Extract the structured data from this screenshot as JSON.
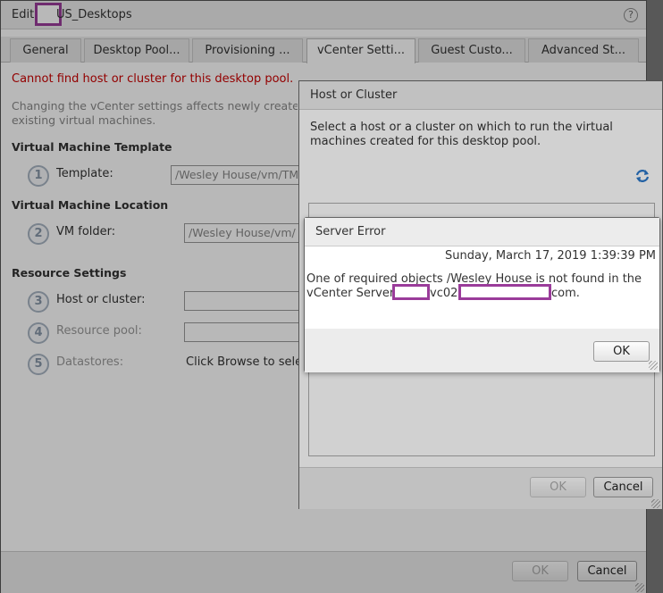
{
  "main_dialog": {
    "title_prefix": "Edit",
    "title_suffix": "US_Desktops",
    "help_icon": "?",
    "tabs": [
      {
        "label": "General"
      },
      {
        "label": "Desktop Pool..."
      },
      {
        "label": "Provisioning ..."
      },
      {
        "label": "vCenter Setti...",
        "active": true
      },
      {
        "label": "Guest Custo..."
      },
      {
        "label": "Advanced St..."
      }
    ],
    "error_line": "Cannot find host or cluster for this desktop pool.",
    "description_line1": "Changing the vCenter settings affects newly create",
    "description_line2": "existing virtual machines.",
    "sections": {
      "template": "Virtual Machine Template",
      "location": "Virtual Machine Location",
      "resource": "Resource Settings"
    },
    "steps": [
      {
        "num": "1",
        "label": "Template:",
        "value": "/Wesley House/vm/TM"
      },
      {
        "num": "2",
        "label": "VM folder:",
        "value": "/Wesley House/vm/"
      },
      {
        "num": "3",
        "label": "Host or cluster:",
        "value": ""
      },
      {
        "num": "4",
        "label": "Resource pool:",
        "value": ""
      },
      {
        "num": "5",
        "label": "Datastores:",
        "value": "Click Browse to sele"
      }
    ],
    "ok_label": "OK",
    "cancel_label": "Cancel"
  },
  "host_dialog": {
    "title": "Host or Cluster",
    "description": "Select a host or a cluster on which to run the virtual machines created for this desktop pool.",
    "refresh_icon": "refresh-icon",
    "ok_label": "OK",
    "cancel_label": "Cancel"
  },
  "error_dialog": {
    "title": "Server Error",
    "timestamp": "Sunday, March 17, 2019 1:39:39 PM",
    "message_line1": "One of required objects /Wesley House is not found in the",
    "message_line2_a": "vCenter Server",
    "message_line2_b": "vc02.",
    "message_line2_c": "com.",
    "ok_label": "OK"
  },
  "colors": {
    "error_text": "#cc0000",
    "redaction_border": "#9a3c9a",
    "title_bar": "#ececec"
  }
}
